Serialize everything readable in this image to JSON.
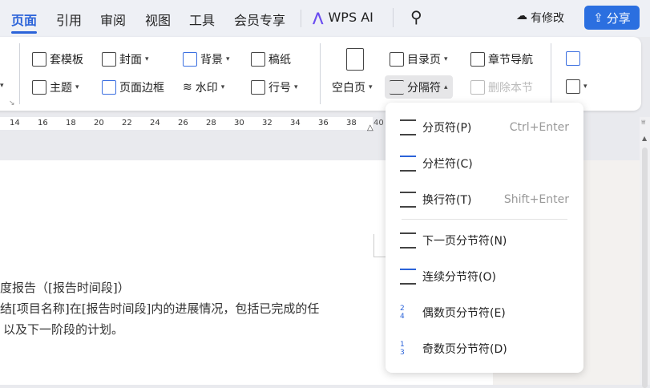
{
  "tabs": [
    "页面",
    "引用",
    "审阅",
    "视图",
    "工具",
    "会员专享"
  ],
  "wps_ai": "WPS AI",
  "modified": "有修改",
  "share": "分享",
  "ribbon": {
    "template": "套模板",
    "cover": "封面",
    "background": "背景",
    "manuscript": "稿纸",
    "theme": "主题",
    "page_border": "页面边框",
    "watermark": "水印",
    "line_number": "行号",
    "blank_page": "空白页",
    "toc_page": "目录页",
    "chapter_nav": "章节导航",
    "separator": "分隔符",
    "delete_section": "删除本节"
  },
  "ruler": [
    "14",
    "16",
    "18",
    "20",
    "22",
    "24",
    "26",
    "28",
    "30",
    "32",
    "34",
    "36",
    "38",
    "40"
  ],
  "doc": {
    "line1": "度报告（[报告时间段]）",
    "line2": "结[项目名称]在[报告时间段]内的进展情况，包括已完成的任",
    "line3": "以及下一阶段的计划。"
  },
  "menu": [
    {
      "label": "分页符(P)",
      "shortcut": "Ctrl+Enter",
      "icon": "page-break-icon"
    },
    {
      "label": "分栏符(C)",
      "shortcut": "",
      "icon": "column-break-icon"
    },
    {
      "label": "换行符(T)",
      "shortcut": "Shift+Enter",
      "icon": "line-break-icon"
    },
    {
      "label": "下一页分节符(N)",
      "shortcut": "",
      "icon": "next-page-section-icon"
    },
    {
      "label": "连续分节符(O)",
      "shortcut": "",
      "icon": "continuous-section-icon"
    },
    {
      "label": "偶数页分节符(E)",
      "shortcut": "",
      "icon": "even-page-section-icon"
    },
    {
      "label": "奇数页分节符(D)",
      "shortcut": "",
      "icon": "odd-page-section-icon"
    }
  ],
  "colors": {
    "accent": "#2b63d9",
    "share_bg": "#2b6fe0"
  }
}
